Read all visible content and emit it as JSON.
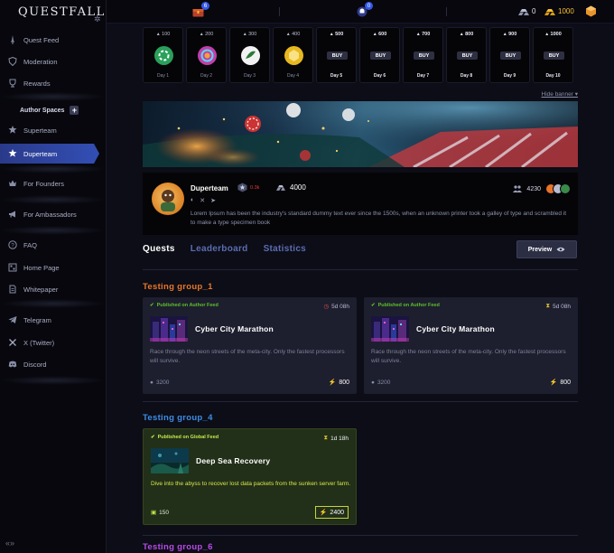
{
  "app": {
    "logo": "QUESTFALL"
  },
  "sidebar": {
    "items": [
      {
        "label": "Quest Feed",
        "icon": "sword-icon"
      },
      {
        "label": "Moderation",
        "icon": "shield-icon"
      },
      {
        "label": "Rewards",
        "icon": "trophy-icon"
      }
    ],
    "author_spaces_label": "Author Spaces",
    "author_spaces_add": "+",
    "spaces": [
      {
        "label": "Superteam",
        "icon": "star-badge-icon"
      },
      {
        "label": "Duperteam",
        "icon": "star-badge-icon",
        "active": true
      }
    ],
    "founders": "For Founders",
    "ambassadors": "For Ambassadors",
    "info_items": [
      {
        "label": "FAQ",
        "icon": "question-icon"
      },
      {
        "label": "Home Page",
        "icon": "home-icon"
      },
      {
        "label": "Whitepaper",
        "icon": "document-icon"
      }
    ],
    "social_items": [
      {
        "label": "Telegram",
        "icon": "telegram-icon"
      },
      {
        "label": "X (Twitter)",
        "icon": "x-icon"
      },
      {
        "label": "Discord",
        "icon": "discord-icon"
      }
    ]
  },
  "topbar": {
    "chest_badge": "6",
    "notif_badge": "0",
    "silver_count": "0",
    "gold_count": "1000"
  },
  "rewards_strip": {
    "days": [
      {
        "amount": "100",
        "label": "Day 1",
        "type": "token",
        "color": "#2aa05a"
      },
      {
        "amount": "200",
        "label": "Day 2",
        "type": "token",
        "color": "#c13fa8"
      },
      {
        "amount": "300",
        "label": "Day 3",
        "type": "token",
        "color": "#f2f2f2"
      },
      {
        "amount": "400",
        "label": "Day 4",
        "type": "token",
        "color": "#e8b820"
      },
      {
        "amount": "500",
        "label": "Day 5",
        "type": "buy",
        "buy": "BUY"
      },
      {
        "amount": "600",
        "label": "Day 6",
        "type": "buy",
        "buy": "BUY"
      },
      {
        "amount": "700",
        "label": "Day 7",
        "type": "buy",
        "buy": "BUY"
      },
      {
        "amount": "800",
        "label": "Day 8",
        "type": "buy",
        "buy": "BUY"
      },
      {
        "amount": "900",
        "label": "Day 9",
        "type": "buy",
        "buy": "BUY"
      },
      {
        "amount": "1000",
        "label": "Day 10",
        "type": "buy",
        "buy": "BUY"
      }
    ],
    "hide_banner": "Hide banner ▾"
  },
  "profile": {
    "name": "Duperteam",
    "level": "0.3k",
    "followers": "4000",
    "members": "4230",
    "description": "Lorem Ipsum has been the industry's standard dummy text ever since the 1500s, when an unknown printer took a galley of type and scrambled it to make a type specimen book"
  },
  "tabs": [
    "Quests",
    "Leaderboard",
    "Statistics"
  ],
  "preview_label": "Preview",
  "groups": [
    {
      "title": "Testing group_1",
      "color": "#e8762a",
      "cards": [
        {
          "published": "Published on Author Feed",
          "time": "5d 08h",
          "title": "Cyber City Marathon",
          "desc": "Race through the neon streets of the meta-city. Only the fastest processors will survive.",
          "xp": "3200",
          "reward": "800"
        },
        {
          "published": "Published on Author Feed",
          "time": "5d 08h",
          "title": "Cyber City Marathon",
          "desc": "Race through the neon streets of the meta-city. Only the fastest processors will survive.",
          "xp": "3200",
          "reward": "800"
        }
      ]
    },
    {
      "title": "Testing group_4",
      "color": "#3d8de8",
      "cards": [
        {
          "published": "Published on Global Feed",
          "time": "1d 18h",
          "title": "Deep Sea Recovery",
          "desc": "Dive into the abyss to recover lost data packets from the sunken server farm.",
          "xp": "150",
          "reward": "2400"
        }
      ]
    },
    {
      "title": "Testing group_6",
      "color": "#b84ae8"
    }
  ]
}
